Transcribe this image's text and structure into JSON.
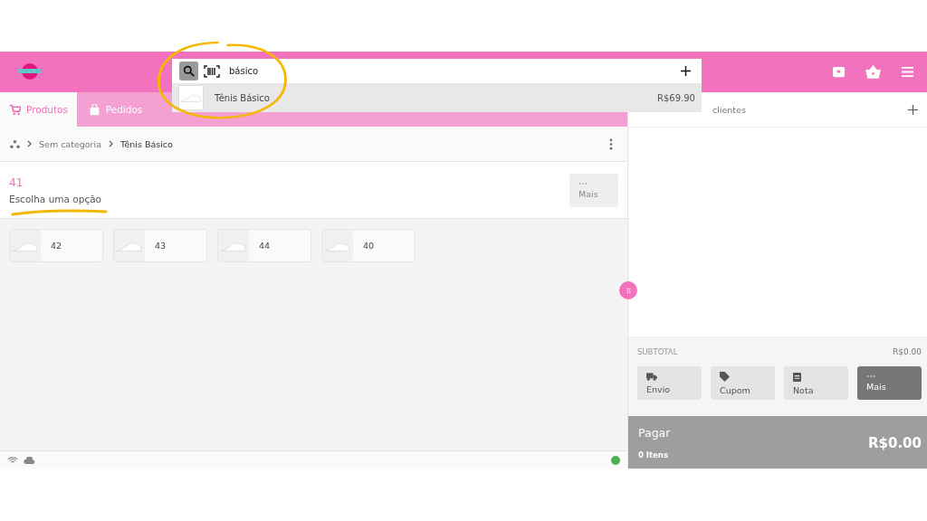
{
  "search": {
    "value": "básico",
    "suggestions": [
      {
        "name": "Tênis Básico",
        "price": "R$69.90"
      }
    ]
  },
  "tabs": [
    {
      "label": "Produtos",
      "selected": true,
      "kind": "cart"
    },
    {
      "label": "Pedidos",
      "selected": false,
      "kind": "bag"
    }
  ],
  "breadcrumb": [
    "Sem categoria",
    "Tênis Básico"
  ],
  "product": {
    "title": "41",
    "subtitle": "Escolha uma opção",
    "more_button": "Mais"
  },
  "variants": [
    {
      "label": "42"
    },
    {
      "label": "43"
    },
    {
      "label": "44"
    },
    {
      "label": "40"
    }
  ],
  "customer": {
    "text": "clientes"
  },
  "cart": {
    "subtotal_label": "SUBTOTAL",
    "subtotal_value": "R$0.00",
    "actions": [
      {
        "label": "Envio",
        "kind": "truck"
      },
      {
        "label": "Cupom",
        "kind": "tag"
      },
      {
        "label": "Nota",
        "kind": "note"
      },
      {
        "label": "Mais",
        "kind": "more"
      }
    ],
    "pay": {
      "label": "Pagar",
      "total": "R$0.00",
      "items": "0 Itens"
    }
  },
  "status": {
    "connected": true
  }
}
